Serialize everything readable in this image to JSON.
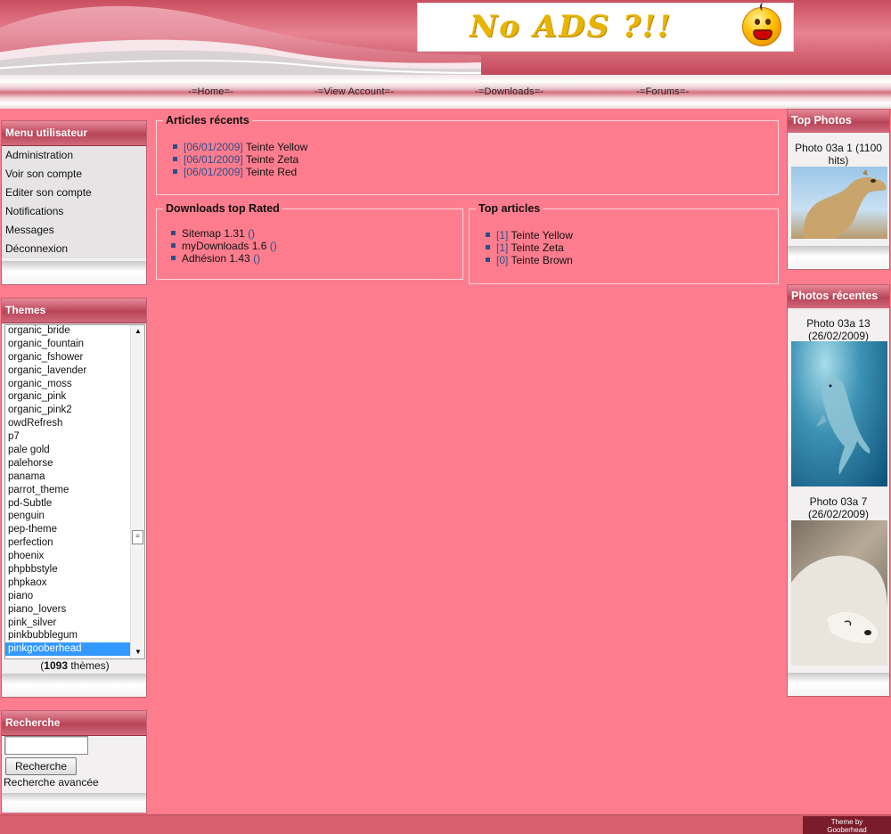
{
  "banner": {
    "text": "No ADS ?!!"
  },
  "nav": {
    "items": [
      "-=Home=-",
      "-=View Account=-",
      "-=Downloads=-",
      "-=Forums=-"
    ]
  },
  "user_menu": {
    "title": "Menu utilisateur",
    "items": [
      "Administration",
      "Voir son compte",
      "Editer son compte",
      "Notifications",
      "Messages",
      "Déconnexion"
    ]
  },
  "themes": {
    "title": "Themes",
    "options": [
      "organic_bride",
      "organic_fountain",
      "organic_fshower",
      "organic_lavender",
      "organic_moss",
      "organic_pink",
      "organic_pink2",
      "owdRefresh",
      "p7",
      "pale gold",
      "palehorse",
      "panama",
      "parrot_theme",
      "pd-Subtle",
      "penguin",
      "pep-theme",
      "perfection",
      "phoenix",
      "phpbbstyle",
      "phpkaox",
      "piano",
      "piano_lovers",
      "pink_silver",
      "pinkbubblegum",
      "pinkgooberhead"
    ],
    "selected": "pinkgooberhead",
    "count": "1093",
    "count_suffix": " thèmes)",
    "count_prefix": "("
  },
  "search": {
    "title": "Recherche",
    "button": "Recherche",
    "advanced": "Recherche avancée",
    "value": ""
  },
  "recent_articles": {
    "title": "Articles récents",
    "items": [
      {
        "date": "[06/01/2009]",
        "title": "Teinte Yellow"
      },
      {
        "date": "[06/01/2009]",
        "title": "Teinte Zeta"
      },
      {
        "date": "[06/01/2009]",
        "title": "Teinte Red"
      }
    ]
  },
  "downloads_top": {
    "title": "Downloads top Rated",
    "items": [
      {
        "name": "Sitemap 1.31",
        "extra": "()"
      },
      {
        "name": "myDownloads 1.6",
        "extra": "()"
      },
      {
        "name": "Adhésion 1.43",
        "extra": "()"
      }
    ]
  },
  "top_articles": {
    "title": "Top articles",
    "items": [
      {
        "rank": "[1]",
        "title": "Teinte Yellow"
      },
      {
        "rank": "[1]",
        "title": "Teinte Zeta"
      },
      {
        "rank": "[0]",
        "title": "Teinte Brown"
      }
    ]
  },
  "top_photos": {
    "title": "Top Photos",
    "caption_line1": "Photo 03a 1 (1100",
    "caption_line2": "hits)",
    "photo": "camel"
  },
  "recent_photos": {
    "title": "Photos récentes",
    "items": [
      {
        "line1": "Photo 03a 13",
        "line2": "(26/02/2009)",
        "photo": "dolphin"
      },
      {
        "line1": "Photo 03a 7",
        "line2": "(26/02/2009)",
        "photo": "polar-bear"
      }
    ]
  },
  "footer": {
    "credit_line1": "Theme by",
    "credit_line2": "Gooberhead"
  },
  "colors": {
    "page_bg": "#fd7d8e",
    "header_pink": "#c94e5f",
    "link_blue": "#2a4f8a",
    "selected_blue": "#3399ff"
  }
}
